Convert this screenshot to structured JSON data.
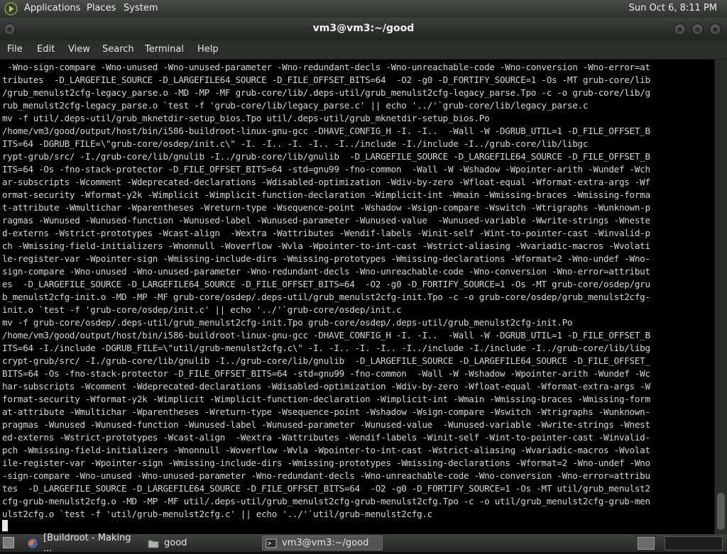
{
  "top_panel": {
    "menus": [
      "Applications",
      "Places",
      "System"
    ],
    "clock": "Sun Oct  6,  8:11 PM"
  },
  "window": {
    "title": "vm3@vm3:~/good"
  },
  "menubar": {
    "items": [
      "File",
      "Edit",
      "View",
      "Search",
      "Terminal",
      "Help"
    ]
  },
  "terminal": {
    "lines": [
      " -Wno-sign-compare -Wno-unused -Wno-unused-parameter -Wno-redundant-decls -Wno-unreachable-code -Wno-conversion -Wno-error=at",
      "tributes  -D_LARGEFILE_SOURCE -D_LARGEFILE64_SOURCE -D_FILE_OFFSET_BITS=64  -O2 -g0 -D_FORTIFY_SOURCE=1 -Os -MT grub-core/lib",
      "/grub_menulst2cfg-legacy_parse.o -MD -MP -MF grub-core/lib/.deps-util/grub_menulst2cfg-legacy_parse.Tpo -c -o grub-core/lib/g",
      "rub_menulst2cfg-legacy_parse.o `test -f 'grub-core/lib/legacy_parse.c' || echo '../'`grub-core/lib/legacy_parse.c",
      "mv -f util/.deps-util/grub_mknetdir-setup_bios.Tpo util/.deps-util/grub_mknetdir-setup_bios.Po",
      "/home/vm3/good/output/host/bin/i586-buildroot-linux-gnu-gcc -DHAVE_CONFIG_H -I. -I..  -Wall -W -DGRUB_UTIL=1 -D_FILE_OFFSET_B",
      "ITS=64 -DGRUB_FILE=\\\"grub-core/osdep/init.c\\\" -I. -I.. -I. -I.. -I../include -I./include -I../grub-core/lib/libgc",
      "rypt-grub/src/ -I./grub-core/lib/gnulib -I../grub-core/lib/gnulib  -D_LARGEFILE_SOURCE -D_LARGEFILE64_SOURCE -D_FILE_OFFSET_B",
      "ITS=64 -Os -fno-stack-protector -D_FILE_OFFSET_BITS=64 -std=gnu99 -fno-common  -Wall -W -Wshadow -Wpointer-arith -Wundef -Wch",
      "ar-subscripts -Wcomment -Wdeprecated-declarations -Wdisabled-optimization -Wdiv-by-zero -Wfloat-equal -Wformat-extra-args -Wf",
      "ormat-security -Wformat-y2k -Wimplicit -Wimplicit-function-declaration -Wimplicit-int -Wmain -Wmissing-braces -Wmissing-forma",
      "t-attribute -Wmultichar -Wparentheses -Wreturn-type -Wsequence-point -Wshadow -Wsign-compare -Wswitch -Wtrigraphs -Wunknown-p",
      "ragmas -Wunused -Wunused-function -Wunused-label -Wunused-parameter -Wunused-value  -Wunused-variable -Wwrite-strings -Wneste",
      "d-externs -Wstrict-prototypes -Wcast-align  -Wextra -Wattributes -Wendif-labels -Winit-self -Wint-to-pointer-cast -Winvalid-p",
      "ch -Wmissing-field-initializers -Wnonnull -Woverflow -Wvla -Wpointer-to-int-cast -Wstrict-aliasing -Wvariadic-macros -Wvolati",
      "le-register-var -Wpointer-sign -Wmissing-include-dirs -Wmissing-prototypes -Wmissing-declarations -Wformat=2 -Wno-undef -Wno-",
      "sign-compare -Wno-unused -Wno-unused-parameter -Wno-redundant-decls -Wno-unreachable-code -Wno-conversion -Wno-error=attribut",
      "es  -D_LARGEFILE_SOURCE -D_LARGEFILE64_SOURCE -D_FILE_OFFSET_BITS=64  -O2 -g0 -D_FORTIFY_SOURCE=1 -Os -MT grub-core/osdep/gru",
      "b_menulst2cfg-init.o -MD -MP -MF grub-core/osdep/.deps-util/grub_menulst2cfg-init.Tpo -c -o grub-core/osdep/grub_menulst2cfg-",
      "init.o `test -f 'grub-core/osdep/init.c' || echo '../'`grub-core/osdep/init.c",
      "mv -f grub-core/osdep/.deps-util/grub_menulst2cfg-init.Tpo grub-core/osdep/.deps-util/grub_menulst2cfg-init.Po",
      "/home/vm3/good/output/host/bin/i586-buildroot-linux-gnu-gcc -DHAVE_CONFIG_H -I. -I..  -Wall -W -DGRUB_UTIL=1 -D_FILE_OFFSET_B",
      "ITS=64 -I./include -DGRUB_FILE=\\\"util/grub-menulst2cfg.c\\\" -I. -I.. -I. -I.. -I../include -I./include -I../grub-core/lib/libg",
      "crypt-grub/src/ -I./grub-core/lib/gnulib -I../grub-core/lib/gnulib  -D_LARGEFILE_SOURCE -D_LARGEFILE64_SOURCE -D_FILE_OFFSET_",
      "BITS=64 -Os -fno-stack-protector -D_FILE_OFFSET_BITS=64 -std=gnu99 -fno-common  -Wall -W -Wshadow -Wpointer-arith -Wundef -Wc",
      "har-subscripts -Wcomment -Wdeprecated-declarations -Wdisabled-optimization -Wdiv-by-zero -Wfloat-equal -Wformat-extra-args -W",
      "format-security -Wformat-y2k -Wimplicit -Wimplicit-function-declaration -Wimplicit-int -Wmain -Wmissing-braces -Wmissing-form",
      "at-attribute -Wmultichar -Wparentheses -Wreturn-type -Wsequence-point -Wshadow -Wsign-compare -Wswitch -Wtrigraphs -Wunknown-",
      "pragmas -Wunused -Wunused-function -Wunused-label -Wunused-parameter -Wunused-value  -Wunused-variable -Wwrite-strings -Wnest",
      "ed-externs -Wstrict-prototypes -Wcast-align  -Wextra -Wattributes -Wendif-labels -Winit-self -Wint-to-pointer-cast -Winvalid-",
      "pch -Wmissing-field-initializers -Wnonnull -Woverflow -Wvla -Wpointer-to-int-cast -Wstrict-aliasing -Wvariadic-macros -Wvolat",
      "ile-register-var -Wpointer-sign -Wmissing-include-dirs -Wmissing-prototypes -Wmissing-declarations -Wformat=2 -Wno-undef -Wno",
      "-sign-compare -Wno-unused -Wno-unused-parameter -Wno-redundant-decls -Wno-unreachable-code -Wno-conversion -Wno-error=attribu",
      "tes  -D_LARGEFILE_SOURCE -D_LARGEFILE64_SOURCE -D_FILE_OFFSET_BITS=64  -O2 -g0 -D_FORTIFY_SOURCE=1 -Os -MT util/grub_menulst2",
      "cfg-grub-menulst2cfg.o -MD -MP -MF util/.deps-util/grub_menulst2cfg-grub-menulst2cfg.Tpo -c -o util/grub_menulst2cfg-grub-men",
      "ulst2cfg.o `test -f 'util/grub-menulst2cfg.c' || echo '../'`util/grub-menulst2cfg.c"
    ]
  },
  "taskbar": {
    "tasks": [
      {
        "label": "[Buildroot - Making ...",
        "icon": "firefox-icon"
      },
      {
        "label": "good",
        "icon": "folder-icon"
      },
      {
        "label": "vm3@vm3:~/good",
        "icon": "terminal-icon"
      }
    ]
  }
}
